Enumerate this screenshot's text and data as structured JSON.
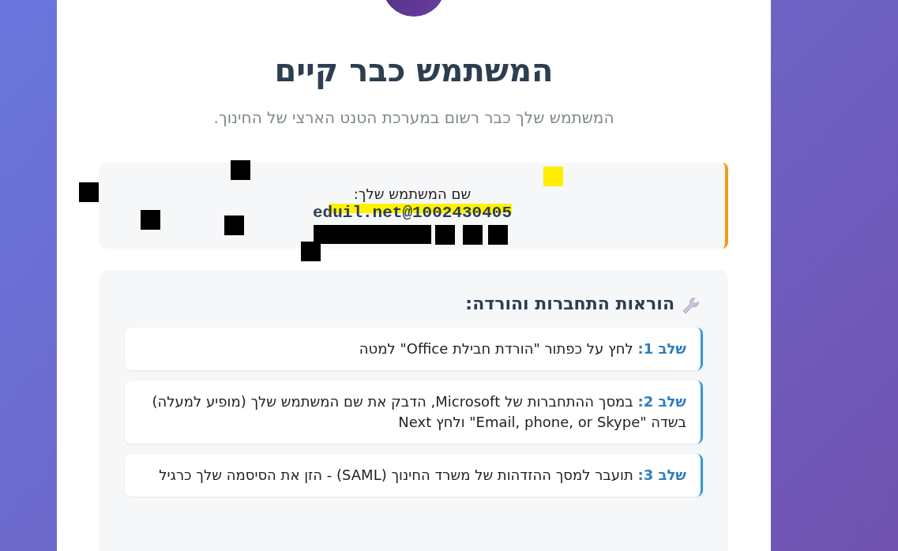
{
  "header": {
    "title": "המשתמש כבר קיים",
    "subtitle": "המשתמש שלך כבר רשום במערכת הטנט הארצי של החינוך."
  },
  "username_box": {
    "label": "שם המשתמש שלך:",
    "username": "eduil.net@1002430405"
  },
  "instructions": {
    "title": "הוראות התחברות והורדה:",
    "steps": [
      "**שלב 1:** לחץ על כפתור \"הורדת חבילת Office\" למטה",
      "**שלב 2:** במסך ההתחברות של Microsoft, הדבק את שם המשתמש שלך (מופיע למעלה) בשדה \"Email, phone, or Skype\" ולחץ Next",
      "**שלב 3:** תועבר למסך ההזדהות של משרד החינוך (SAML) - הזן את הסיסמה שלך כרגיל"
    ]
  }
}
